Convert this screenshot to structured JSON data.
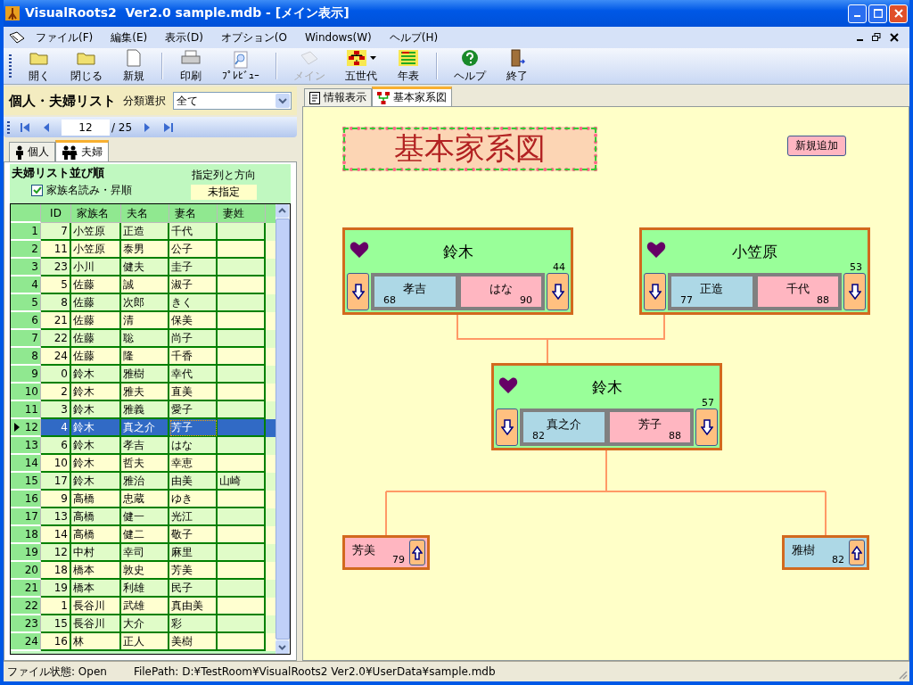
{
  "window": {
    "title": "VisualRoots2  Ver2.0 sample.mdb - [メイン表示]"
  },
  "menu": [
    "ファイル(F)",
    "編集(E)",
    "表示(D)",
    "オプション(O",
    "Windows(W)",
    "ヘルプ(H)"
  ],
  "toolbar": [
    [
      {
        "label": "開く",
        "disabled": false,
        "has_menu": false
      },
      {
        "label": "閉じる",
        "disabled": false,
        "has_menu": false
      },
      {
        "label": "新規",
        "disabled": false,
        "has_menu": false
      }
    ],
    [
      {
        "label": "印刷",
        "disabled": false,
        "has_menu": false
      },
      {
        "label": "ﾌﾟﾚﾋﾞｭｰ",
        "disabled": false,
        "has_menu": false
      }
    ],
    [
      {
        "label": "メイン",
        "disabled": true,
        "has_menu": false
      },
      {
        "label": "五世代",
        "disabled": false,
        "has_menu": true
      },
      {
        "label": "年表",
        "disabled": false,
        "has_menu": false
      }
    ],
    [
      {
        "label": "ヘルプ",
        "disabled": false,
        "has_menu": false
      },
      {
        "label": "終了",
        "disabled": false,
        "has_menu": false
      }
    ]
  ],
  "list_panel": {
    "title": "個人・夫婦リスト",
    "filter_label": "分類選択",
    "filter_value": "全て",
    "navigator": {
      "current": "12",
      "total": "/ 25"
    },
    "tabs": [
      {
        "label": "個人",
        "selected": false
      },
      {
        "label": "夫婦",
        "selected": true
      }
    ],
    "sort": {
      "title": "夫婦リスト並び順",
      "checkbox": {
        "label": "家族名読み・昇順",
        "checked": true
      },
      "column_label": "指定列と方向",
      "column_value": "未指定"
    },
    "table": {
      "columns": [
        "ID",
        "家族名",
        "夫名",
        "妻名",
        "妻姓"
      ],
      "rows": [
        {
          "no": "1",
          "id": "7",
          "family": "小笠原",
          "husband": "正造",
          "wife": "千代",
          "selected": false
        },
        {
          "no": "2",
          "id": "11",
          "family": "小笠原",
          "husband": "泰男",
          "wife": "公子",
          "selected": false
        },
        {
          "no": "3",
          "id": "23",
          "family": "小川",
          "husband": "健夫",
          "wife": "圭子",
          "selected": false
        },
        {
          "no": "4",
          "id": "5",
          "family": "佐藤",
          "husband": "誠",
          "wife": "淑子",
          "selected": false
        },
        {
          "no": "5",
          "id": "8",
          "family": "佐藤",
          "husband": "次郎",
          "wife": "きく",
          "selected": false
        },
        {
          "no": "6",
          "id": "21",
          "family": "佐藤",
          "husband": "清",
          "wife": "保美",
          "selected": false
        },
        {
          "no": "7",
          "id": "22",
          "family": "佐藤",
          "husband": "聡",
          "wife": "尚子",
          "selected": false
        },
        {
          "no": "8",
          "id": "24",
          "family": "佐藤",
          "husband": "隆",
          "wife": "千香",
          "selected": false
        },
        {
          "no": "9",
          "id": "0",
          "family": "鈴木",
          "husband": "雅樹",
          "wife": "幸代",
          "selected": false
        },
        {
          "no": "10",
          "id": "2",
          "family": "鈴木",
          "husband": "雅夫",
          "wife": "直美",
          "selected": false
        },
        {
          "no": "11",
          "id": "3",
          "family": "鈴木",
          "husband": "雅義",
          "wife": "愛子",
          "selected": false
        },
        {
          "no": "12",
          "id": "4",
          "family": "鈴木",
          "husband": "真之介",
          "wife": "芳子",
          "selected": true
        },
        {
          "no": "13",
          "id": "6",
          "family": "鈴木",
          "husband": "孝吉",
          "wife": "はな",
          "selected": false
        },
        {
          "no": "14",
          "id": "10",
          "family": "鈴木",
          "husband": "哲夫",
          "wife": "幸恵",
          "selected": false
        },
        {
          "no": "15",
          "id": "17",
          "family": "鈴木",
          "husband": "雅治",
          "wife": "由美",
          "wife_surname": "山崎",
          "selected": false
        },
        {
          "no": "16",
          "id": "9",
          "family": "高橋",
          "husband": "忠蔵",
          "wife": "ゆき",
          "selected": false
        },
        {
          "no": "17",
          "id": "13",
          "family": "高橋",
          "husband": "健一",
          "wife": "光江",
          "selected": false
        },
        {
          "no": "18",
          "id": "14",
          "family": "高橋",
          "husband": "健二",
          "wife": "敬子",
          "selected": false
        },
        {
          "no": "19",
          "id": "12",
          "family": "中村",
          "husband": "幸司",
          "wife": "麻里",
          "selected": false
        },
        {
          "no": "20",
          "id": "18",
          "family": "橋本",
          "husband": "敦史",
          "wife": "芳美",
          "selected": false
        },
        {
          "no": "21",
          "id": "19",
          "family": "橋本",
          "husband": "利雄",
          "wife": "民子",
          "selected": false
        },
        {
          "no": "22",
          "id": "1",
          "family": "長谷川",
          "husband": "武雄",
          "wife": "真由美",
          "selected": false
        },
        {
          "no": "23",
          "id": "15",
          "family": "長谷川",
          "husband": "大介",
          "wife": "彩",
          "selected": false
        },
        {
          "no": "24",
          "id": "16",
          "family": "林",
          "husband": "正人",
          "wife": "美樹",
          "selected": false
        }
      ]
    }
  },
  "view_tabs": [
    {
      "label": "情報表示",
      "selected": false
    },
    {
      "label": "基本家系図",
      "selected": true
    }
  ],
  "family_tree": {
    "title": "基本家系図",
    "add_button": "新規追加",
    "families": [
      {
        "surname": "鈴木",
        "years": "44",
        "husband": {
          "name": "孝吉",
          "age": "68"
        },
        "wife": {
          "name": "はな",
          "age": "90"
        }
      },
      {
        "surname": "小笠原",
        "years": "53",
        "husband": {
          "name": "正造",
          "age": "77"
        },
        "wife": {
          "name": "千代",
          "age": "88"
        }
      },
      {
        "surname": "鈴木",
        "years": "57",
        "husband": {
          "name": "真之介",
          "age": "82"
        },
        "wife": {
          "name": "芳子",
          "age": "88"
        }
      }
    ],
    "children": [
      {
        "name": "芳美",
        "age": "79",
        "color": "#ffb6c1"
      },
      {
        "name": "雅樹",
        "age": "82",
        "color": "#add8e6"
      }
    ]
  },
  "status_bar": {
    "file_state": "ファイル状態: Open",
    "file_path": "FilePath: D:¥TestRoom¥VisualRoots2 Ver2.0¥UserData¥sample.mdb"
  }
}
